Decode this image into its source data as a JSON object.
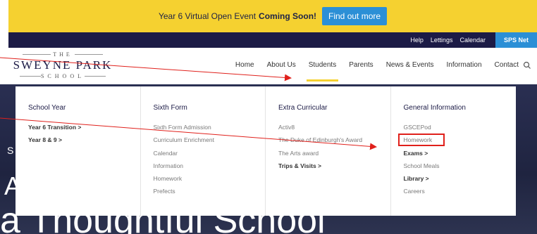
{
  "banner": {
    "text": "Year 6 Virtual Open Event",
    "strong": "Coming Soon!",
    "button": "Find out more"
  },
  "topbar": {
    "links": [
      "Help",
      "Lettings",
      "Calendar"
    ],
    "sps": "SPS Net"
  },
  "logo": {
    "the": "THE",
    "name": "SWEYNE PARK",
    "school": "SCHOOL"
  },
  "nav": {
    "items": [
      "Home",
      "About Us",
      "Students",
      "Parents",
      "News & Events",
      "Information",
      "Contact"
    ]
  },
  "mega": {
    "columns": [
      {
        "heading": "School Year",
        "items": [
          "Year 6 Transition  >",
          "Year 8 & 9  >"
        ]
      },
      {
        "heading": "Sixth Form",
        "items": [
          "Sixth Form Admission",
          "Curriculum Enrichment",
          "Calendar",
          "Information",
          "Homework",
          "Prefects"
        ]
      },
      {
        "heading": "Extra Curricular",
        "items": [
          "Activ8",
          "The Duke of Edinburgh's Award",
          "The Arts award",
          "Trips & Visits  >"
        ]
      },
      {
        "heading": "General Information",
        "items": [
          "GSCEPod",
          "Homework",
          "Exams  >",
          "School Meals",
          "Library  >",
          "Careers"
        ]
      }
    ]
  },
  "hero": {
    "letter_s": "S",
    "letter_a": "A",
    "tagline": "a Thoughtful School"
  },
  "colors": {
    "banner": "#f5d130",
    "navy": "#1c1b46",
    "accent_blue": "#2b8fd6",
    "annotation_red": "#e0201b"
  }
}
